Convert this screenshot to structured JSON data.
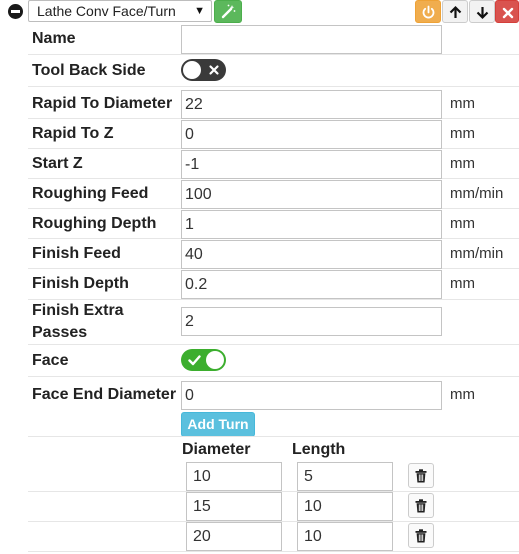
{
  "toolbar": {
    "operation_type": "Lathe Conv Face/Turn",
    "icons": [
      "minus-circle-icon",
      "caret-down-icon",
      "magic-wand-icon",
      "power-icon",
      "arrow-up-icon",
      "arrow-down-icon",
      "close-icon"
    ],
    "colors": {
      "wand": "#5cb85c",
      "power": "#f0ad4e",
      "delete": "#d9534f"
    }
  },
  "form": {
    "name": {
      "label": "Name",
      "value": ""
    },
    "tool_back_side": {
      "label": "Tool Back Side",
      "enabled": false
    },
    "rapid_to_diameter": {
      "label": "Rapid To Diameter",
      "value": "22",
      "unit": "mm"
    },
    "rapid_to_z": {
      "label": "Rapid To Z",
      "value": "0",
      "unit": "mm"
    },
    "start_z": {
      "label": "Start Z",
      "value": "-1",
      "unit": "mm"
    },
    "roughing_feed": {
      "label": "Roughing Feed",
      "value": "100",
      "unit": "mm/min"
    },
    "roughing_depth": {
      "label": "Roughing Depth",
      "value": "1",
      "unit": "mm"
    },
    "finish_feed": {
      "label": "Finish Feed",
      "value": "40",
      "unit": "mm/min"
    },
    "finish_depth": {
      "label": "Finish Depth",
      "value": "0.2",
      "unit": "mm"
    },
    "finish_extra_passes": {
      "label_line1": "Finish Extra",
      "label_line2": "Passes",
      "value": "2"
    },
    "face": {
      "label": "Face",
      "enabled": true
    },
    "face_end_diameter": {
      "label": "Face End Diameter",
      "value": "0",
      "unit": "mm"
    }
  },
  "turns": {
    "add_label": "Add Turn",
    "columns": [
      "Diameter",
      "Length"
    ],
    "rows": [
      {
        "diameter": "10",
        "length": "5"
      },
      {
        "diameter": "15",
        "length": "10"
      },
      {
        "diameter": "20",
        "length": "10"
      }
    ]
  }
}
